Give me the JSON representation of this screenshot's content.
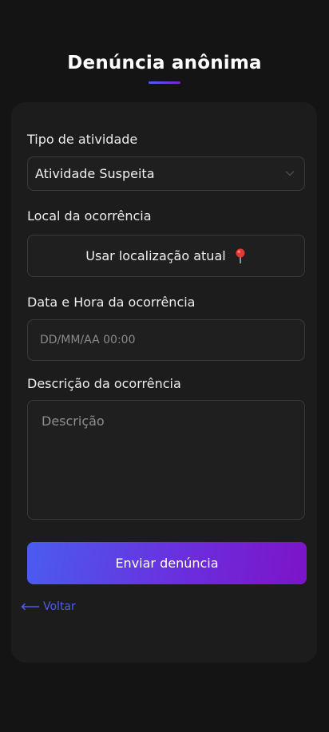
{
  "header": {
    "title": "Denúncia anônima",
    "accent_start": "#4a63f0",
    "accent_end": "#7d1fd0"
  },
  "form": {
    "activity_type": {
      "label": "Tipo de atividade",
      "selected": "Atividade Suspeita",
      "icon": "chevron-down-icon"
    },
    "location": {
      "label": "Local da ocorrência",
      "button_label": "Usar localização atual",
      "icon": "map-pin-icon"
    },
    "datetime": {
      "label": "Data e Hora da ocorrência",
      "placeholder": "DD/MM/AA 00:00",
      "value": ""
    },
    "description": {
      "label": "Descrição da ocorrência",
      "placeholder": "Descrição",
      "value": ""
    },
    "submit_label": "Enviar denúncia",
    "back_label": "Voltar",
    "back_icon": "arrow-left-icon"
  }
}
